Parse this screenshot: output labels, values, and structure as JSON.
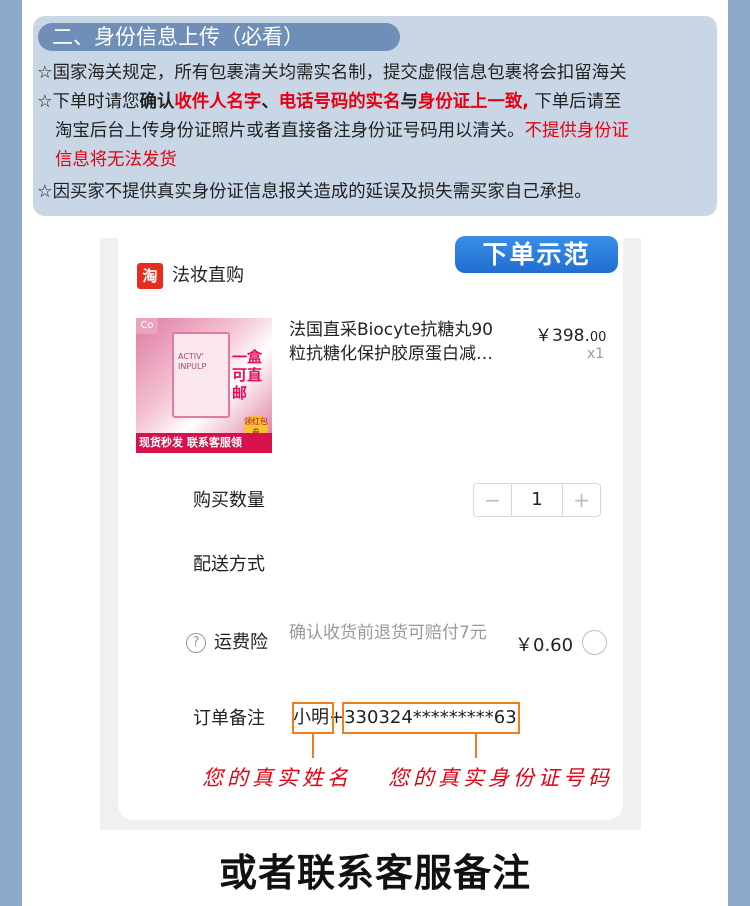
{
  "notice": {
    "title": "二、身份信息上传（必看）",
    "line1": "☆国家海关规定，所有包裹清关均需实名制，提交虚假信息包裹将会扣留海关",
    "line2_a": "☆下单时请您",
    "line2_b": "确认",
    "line2_c": "收件人名字",
    "line2_d": "、",
    "line2_e": "电话号码的实名",
    "line2_f": "与",
    "line2_g": "身份证上一致,",
    "line2_h": " 下单后请至",
    "line3_a": "淘宝后台上传身份证照片或者直接备注身份证号码用以清关。",
    "line3_b": "不提供身份证",
    "line4": "信息将无法发货",
    "line5": "☆因买家不提供真实身份证信息报关造成的延误及损失需买家自己承担。"
  },
  "order": {
    "badge": "下单示范",
    "shop_logo": "淘",
    "shop_name": "法妆直购",
    "product": {
      "title": "法国直采Biocyte抗糖丸90粒抗糖化保护胶原蛋白减…",
      "price_int": "￥398.",
      "price_dec": "00",
      "qty": "x1",
      "image_texts": {
        "corner": "Co",
        "box": "ACTIV' INPULP",
        "stamp": "一盒可直邮",
        "bottom": "现货秒发 联系客服领",
        "badge": "领红包券"
      }
    },
    "qty_label": "购买数量",
    "qty_value": "1",
    "minus": "−",
    "plus": "+",
    "shipping_label": "配送方式",
    "insurance_label": "运费险",
    "insurance_desc": "确认收货前退货可赔付7元",
    "insurance_price": "￥0.60",
    "help": "?",
    "note_label": "订单备注",
    "note_value": "小明+330324*********63",
    "hint_name": "您的真实姓名",
    "hint_id": "您的真实身份证号码"
  },
  "footer": "或者联系客服备注",
  "colors": {
    "accent_red": "#e60012",
    "annotation_orange": "#f07c1a",
    "panel_blue": "#c9d6e5",
    "badge_blue": "#1f6fd1"
  }
}
